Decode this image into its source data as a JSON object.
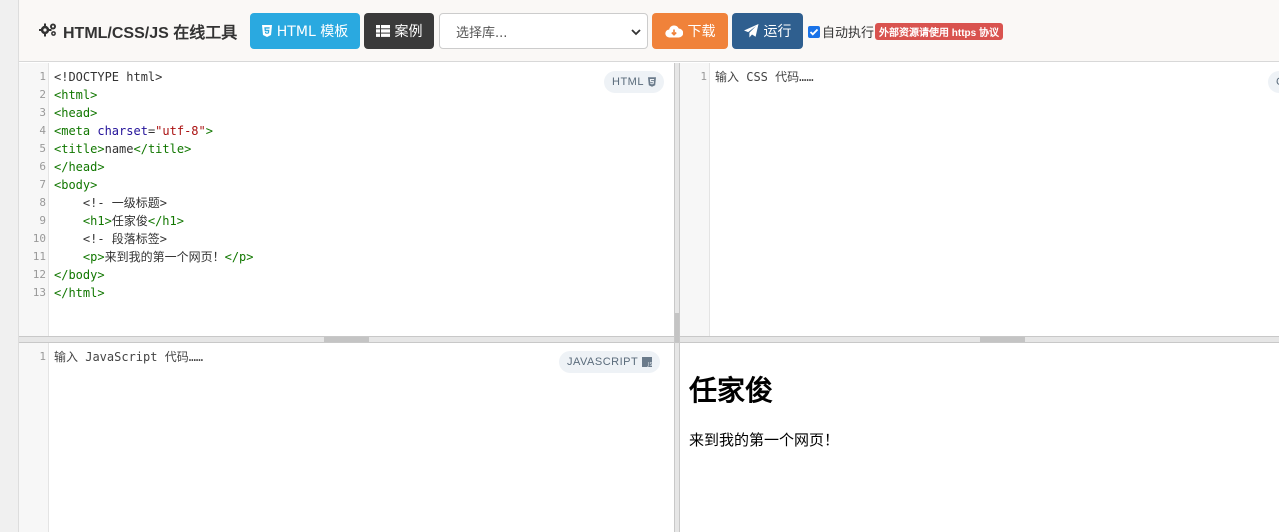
{
  "toolbar": {
    "title": "HTML/CSS/JS 在线工具",
    "title_icon": "gears-icon",
    "html_template_label": "HTML 模板",
    "cases_label": "案例",
    "library_select": {
      "placeholder": "选择库..."
    },
    "download_label": "下载",
    "run_label": "运行",
    "auto_run": {
      "label": "自动执行",
      "checked": true
    },
    "https_badge": "外部资源请使用 https 协议",
    "colors": {
      "html_btn": "#2aa9e0",
      "case_btn": "#3a3a3a",
      "download_btn": "#f0823a",
      "run_btn": "#2f5f8f",
      "badge": "#d9534f"
    }
  },
  "html_editor": {
    "lang_label": "HTML",
    "line_numbers": [
      "1",
      "2",
      "3",
      "4",
      "5",
      "6",
      "7",
      "8",
      "9",
      "10",
      "11",
      "12",
      "13"
    ],
    "lines": [
      "<!DOCTYPE html>",
      "<html>",
      "<head>",
      "<meta charset=\"utf-8\">",
      "<title>name</title>",
      "</head>",
      "<body>",
      "    <!- 一级标题>",
      "    <h1>任家俊</h1>",
      "    <!- 段落标签>",
      "    <p>来到我的第一个网页！</p>",
      "</body>",
      "</html>"
    ]
  },
  "css_editor": {
    "line_numbers": [
      "1"
    ],
    "placeholder": "输入 CSS 代码……",
    "lang_label": "C"
  },
  "js_editor": {
    "lang_label": "JAVASCRIPT",
    "line_numbers": [
      "1"
    ],
    "placeholder": "输入 JavaScript 代码……"
  },
  "output": {
    "heading": "任家俊",
    "paragraph": "来到我的第一个网页！"
  }
}
